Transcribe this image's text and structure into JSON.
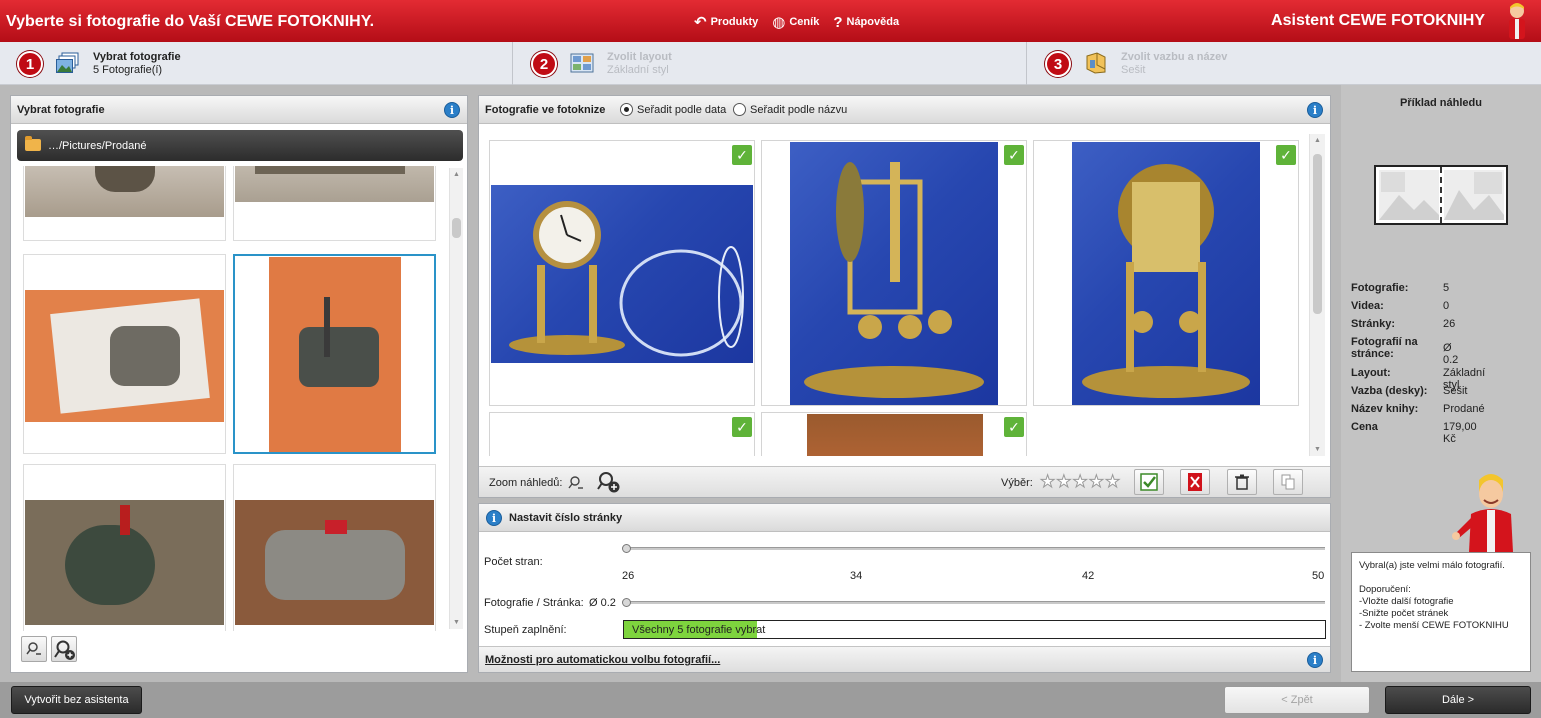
{
  "window": {
    "title": "Vyberte si fotografie do Vaší CEWE FOTOKNIHY.",
    "assistant_title": "Asistent CEWE FOTOKNIHY",
    "menu": {
      "products": "Produkty",
      "pricing": "Ceník",
      "help": "Nápověda"
    }
  },
  "steps": [
    {
      "number": "1",
      "title": "Vybrat fotografie",
      "subtitle": "5 Fotografie(í)",
      "active": true
    },
    {
      "number": "2",
      "title": "Zvolit layout",
      "subtitle": "Základní styl",
      "active": false
    },
    {
      "number": "3",
      "title": "Zvolit vazbu a název",
      "subtitle": "Sešit",
      "active": false
    }
  ],
  "left_panel": {
    "title": "Vybrat fotografie",
    "path": "…/Pictures/Prodané",
    "info_icon": "i"
  },
  "center_panel": {
    "title": "Fotografie ve fotoknize",
    "sort_by_date": "Seřadit podle data",
    "sort_by_name": "Seřadit podle názvu",
    "sort_selected": "date",
    "zoom_label": "Zoom náhledů:",
    "selection_label": "Výběr:",
    "rating": 0,
    "check_symbol": "✓"
  },
  "page_panel": {
    "title": "Nastavit číslo stránky",
    "pages_label": "Počet stran:",
    "ticks": [
      "26",
      "34",
      "42",
      "50"
    ],
    "pages_value": 26,
    "photos_per_page_label": "Fotografie / Stránka:",
    "photos_per_page_value": "Ø 0.2",
    "fill_label": "Stupeň zaplnění:",
    "fill_text": "Všechny 5 fotografie vybrat",
    "fill_fraction": 0.19,
    "auto_link": "Možnosti pro automatickou volbu fotografií..."
  },
  "right_panel": {
    "preview_title": "Příklad náhledu",
    "stats": [
      {
        "key": "Fotografie:",
        "value": "5"
      },
      {
        "key": "Videa:",
        "value": "0"
      },
      {
        "key": "Stránky:",
        "value": "26"
      },
      {
        "key": "Fotografií na stránce:",
        "value": "Ø 0.2"
      },
      {
        "key": "Layout:",
        "value": "Základní styl"
      },
      {
        "key": "Vazba (desky):",
        "value": "Sešit"
      },
      {
        "key": "Název knihy:",
        "value": "Prodané"
      },
      {
        "key": "Cena",
        "value": "179,00 Kč"
      }
    ],
    "tip_lines": [
      "Vybral(a) jste velmi málo fotografií.",
      "",
      "Doporučení:",
      "-Vložte další fotografie",
      "-Snižte počet stránek",
      "- Zvolte menší CEWE FOTOKNIHU"
    ]
  },
  "bottom": {
    "create_without": "Vytvořit bez asistenta",
    "back": "< Zpět",
    "next": "Dále >"
  },
  "colors": {
    "brand_red": "#c8101a",
    "check_green": "#5fb339",
    "fill_green": "#7ed43e",
    "selection_blue": "#2a93c8"
  }
}
